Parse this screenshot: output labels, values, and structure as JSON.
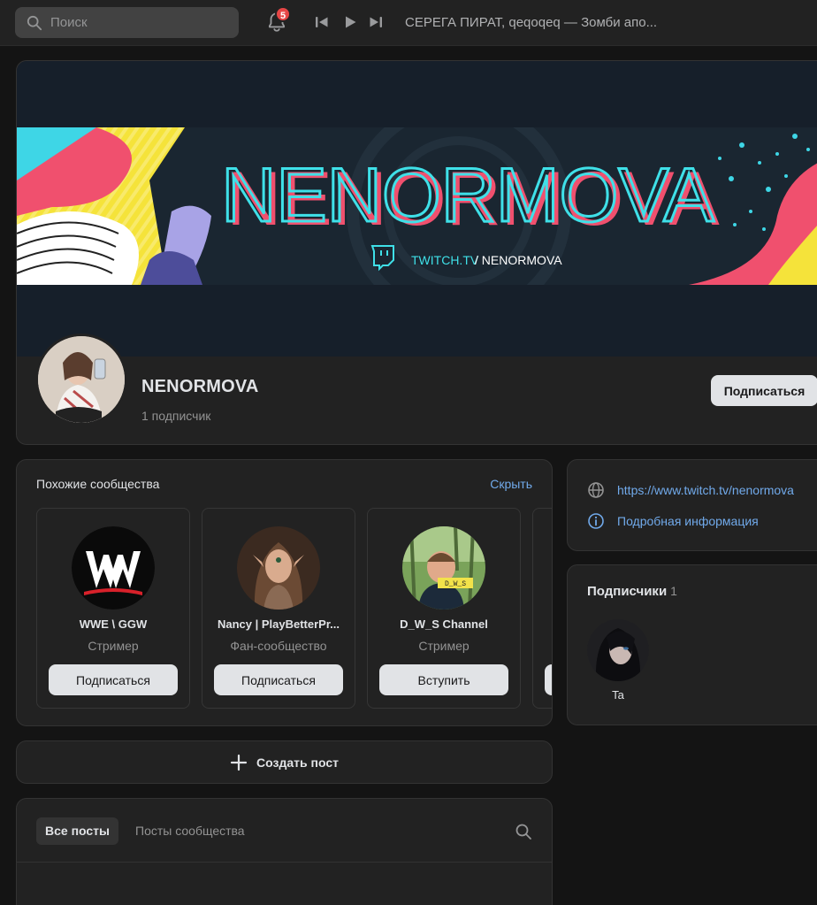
{
  "topbar": {
    "search_placeholder": "Поиск",
    "notifications_count": "5",
    "now_playing": "СЕРЕГА ПИРАТ, qeqoqeq — Зомби апо..."
  },
  "header": {
    "banner_title": "NENORMOVA",
    "banner_link_domain": "TWITCH.TV",
    "banner_link_path": " / NENORMOVA",
    "group_name": "NENORMOVA",
    "subscribers": "1 подписчик",
    "subscribe_label": "Подписаться"
  },
  "similar": {
    "title": "Похожие сообщества",
    "hide_label": "Скрыть",
    "items": [
      {
        "name": "WWE \\ GGW",
        "type": "Стример",
        "button": "Подписаться"
      },
      {
        "name": "Nancy | PlayBetterPr...",
        "type": "Фан-сообщество",
        "button": "Подписаться"
      },
      {
        "name": "D_W_S Channel",
        "type": "Стример",
        "button": "Вступить",
        "avatar_badge": "D_W_S"
      }
    ]
  },
  "create_post": {
    "label": "Создать пост"
  },
  "posts": {
    "tabs": [
      {
        "label": "Все посты",
        "active": true
      },
      {
        "label": "Посты сообщества",
        "active": false
      }
    ]
  },
  "info": {
    "website": "https://www.twitch.tv/nenormova",
    "details_label": "Подробная информация"
  },
  "followers": {
    "title": "Подписчики",
    "count": "1",
    "items": [
      {
        "name": "Ta"
      }
    ]
  },
  "colors": {
    "accent_link": "#71aaeb",
    "card_bg": "#222222",
    "page_bg": "#141414",
    "button_light": "#e1e3e6",
    "badge_red": "#e64646",
    "banner_cyan": "#3fe0e8",
    "banner_pink": "#f0506e",
    "banner_yellow": "#f5e33a"
  }
}
